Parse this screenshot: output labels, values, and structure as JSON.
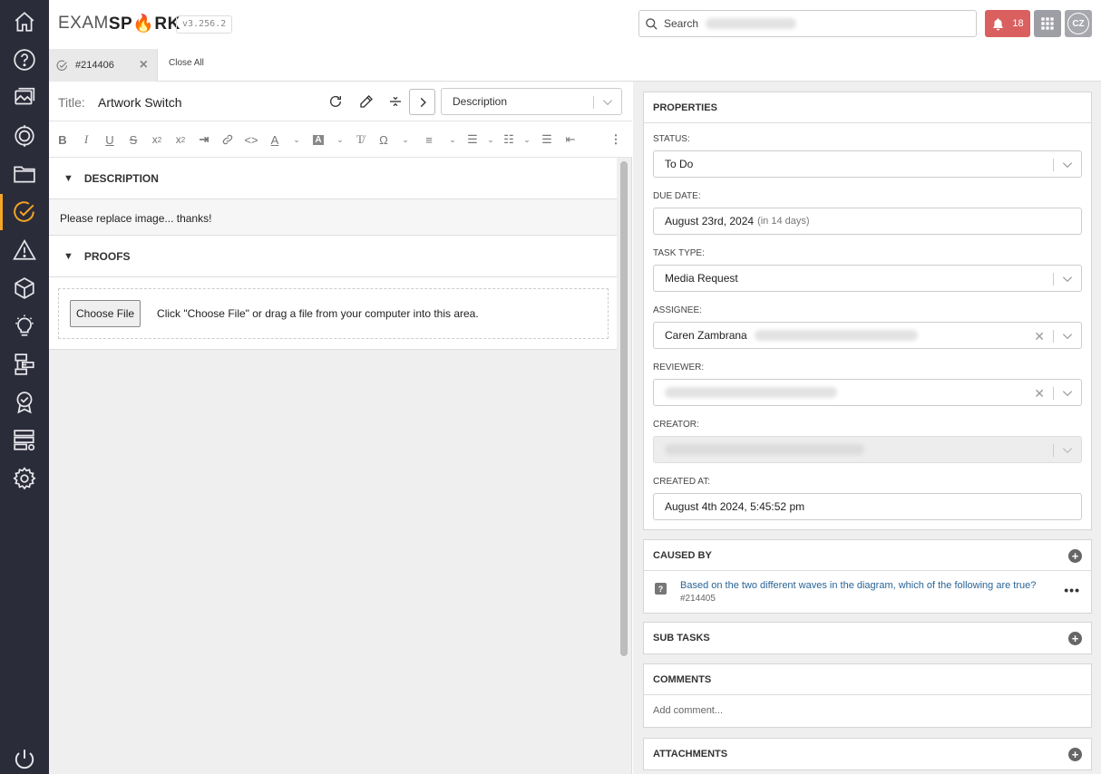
{
  "app": {
    "logo_exam": "EXAM",
    "logo_spark": "SPARK",
    "version": "v3.256.2"
  },
  "sidebar": {
    "items": [
      {
        "name": "home-icon"
      },
      {
        "name": "question-icon"
      },
      {
        "name": "image-gallery-icon"
      },
      {
        "name": "target-icon"
      },
      {
        "name": "folder-icon"
      },
      {
        "name": "tasks-check-icon",
        "active": true
      },
      {
        "name": "warning-icon"
      },
      {
        "name": "cube-icon"
      },
      {
        "name": "lightbulb-icon"
      },
      {
        "name": "workflow-icon"
      },
      {
        "name": "award-icon"
      },
      {
        "name": "server-settings-icon"
      },
      {
        "name": "gear-icon"
      },
      {
        "name": "power-icon"
      }
    ]
  },
  "header": {
    "search_label": "Search",
    "notification_count": "18",
    "avatar_initials": "CZ"
  },
  "tabs": {
    "active_tab": "#214406",
    "close_all": "Close All"
  },
  "task": {
    "title_label": "Title:",
    "title_value": "Artwork Switch",
    "view_select": "Description",
    "sections": {
      "description_heading": "DESCRIPTION",
      "description_text": "Please replace image... thanks!",
      "proofs_heading": "PROOFS",
      "choose_file": "Choose File",
      "upload_hint": "Click \"Choose File\" or drag a file from your computer into this area."
    }
  },
  "properties": {
    "heading": "PROPERTIES",
    "status_label": "STATUS:",
    "status_value": "To Do",
    "due_label": "DUE DATE:",
    "due_value": "August 23rd, 2024",
    "due_relative": "(in 14 days)",
    "type_label": "TASK TYPE:",
    "type_value": "Media Request",
    "assignee_label": "ASSIGNEE:",
    "assignee_value": "Caren Zambrana",
    "reviewer_label": "REVIEWER:",
    "creator_label": "CREATOR:",
    "created_label": "CREATED AT:",
    "created_value": "August 4th 2024, 5:45:52 pm"
  },
  "caused_by": {
    "heading": "CAUSED BY",
    "item_text": "Based on the two different waves in the diagram, which of the following are true?",
    "item_id": "#214405"
  },
  "sub_tasks": {
    "heading": "SUB TASKS"
  },
  "comments": {
    "heading": "COMMENTS",
    "placeholder": "Add comment..."
  },
  "attachments": {
    "heading": "ATTACHMENTS"
  },
  "colors": {
    "sidebar_bg": "#2b2c3a",
    "accent": "#f5a623",
    "notify": "#d9605f",
    "link": "#2a6496"
  }
}
